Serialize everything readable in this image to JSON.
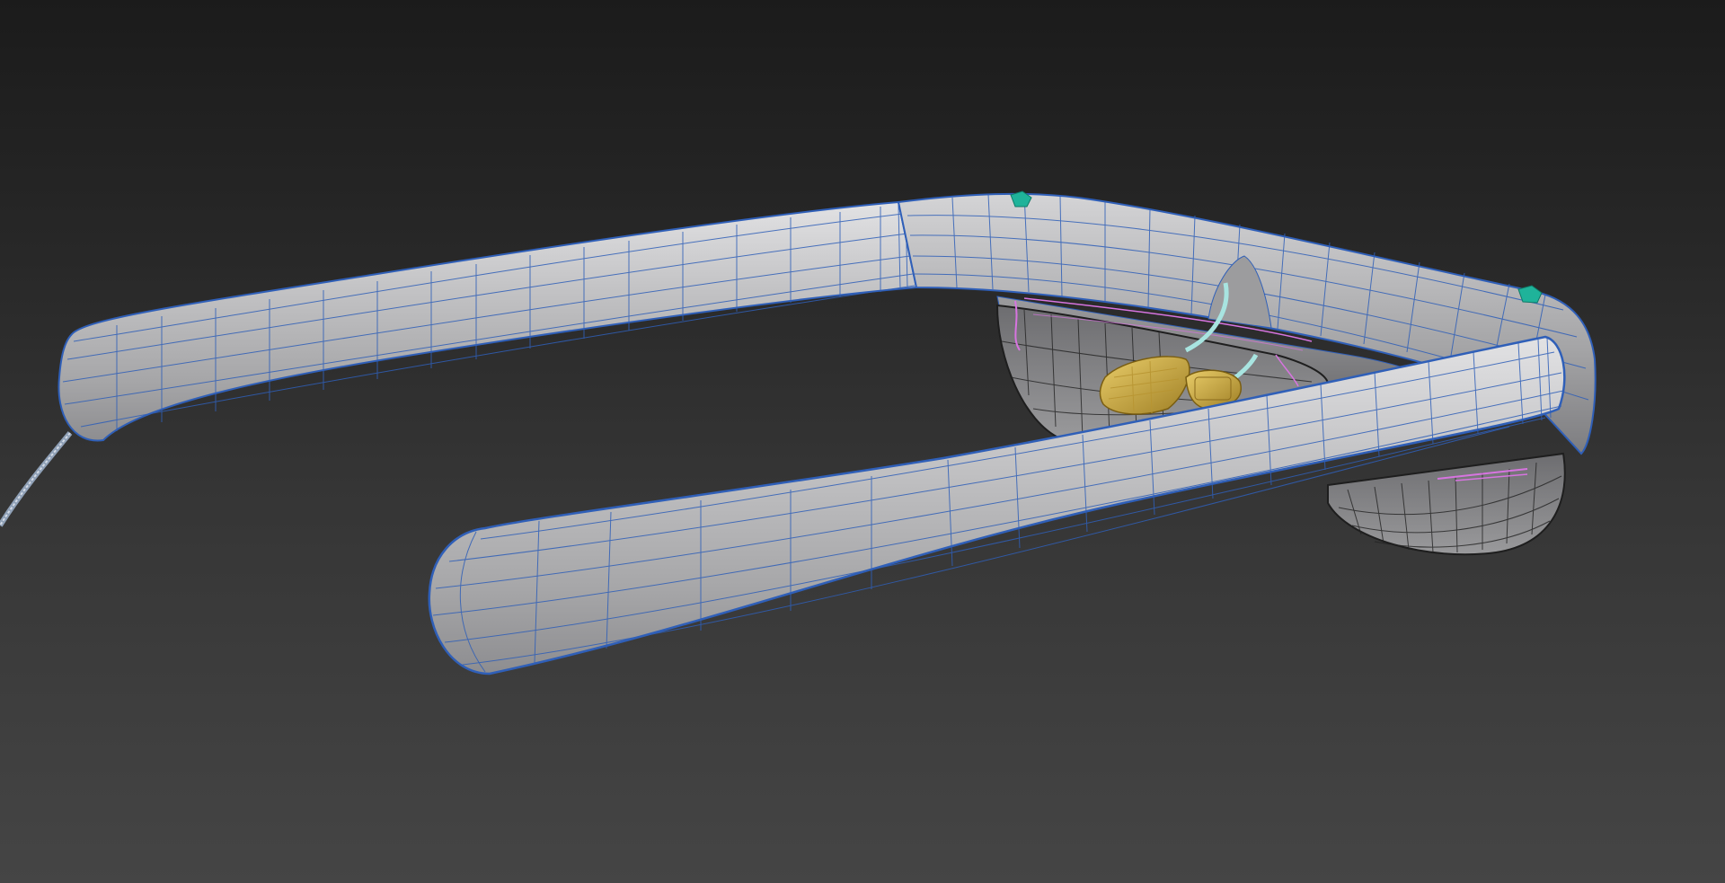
{
  "viewport": {
    "background_top": "#1b1b1b",
    "background_bottom": "#454545"
  },
  "model": {
    "surface_color": "#b9b9bb",
    "wire_color": "#2f5fb8",
    "lens_wire_color": "#1e1e1e",
    "selection_color": "#d774e0",
    "component_color": "#d9b441",
    "cable_color": "#a8e4e0",
    "marker_color": "#1fb39a"
  }
}
